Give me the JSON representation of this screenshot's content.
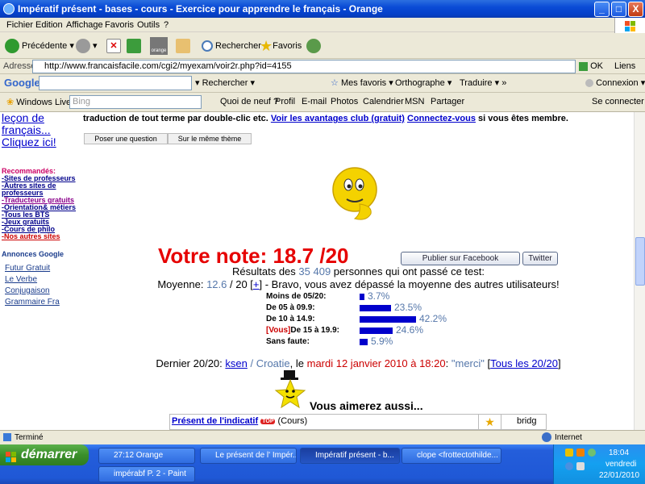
{
  "window": {
    "title": "Impératif présent - bases - cours - Exercice pour apprendre le français - Orange",
    "min": "_",
    "max": "□",
    "close": "X"
  },
  "menu": [
    "Fichier",
    "Edition",
    "Affichage",
    "Favoris",
    "Outils",
    "?"
  ],
  "toolbar": {
    "back": "Précédente",
    "search": "Rechercher",
    "favorites": "Favoris",
    "orange": "orange"
  },
  "address": {
    "label": "Adresse",
    "url": "http://www.francaisfacile.com/cgi2/myexam/voir2r.php?id=4155",
    "go": "OK",
    "links": "Liens"
  },
  "googlebar": {
    "logo": "Google",
    "search": "Rechercher",
    "favorites": "Mes favoris",
    "spell": "Orthographe",
    "translate": "Traduire",
    "connect": "Connexion"
  },
  "livebar": {
    "brand": "Windows Live",
    "placeholder": "Bing",
    "items": [
      "Quoi de neuf ?",
      "Profil",
      "E-mail",
      "Photos",
      "Calendrier",
      "MSN",
      "Partager"
    ],
    "signin": "Se connecter"
  },
  "sidebar": {
    "promo": "leçon de français... Cliquez ici!",
    "reco_title": "Recommandés:",
    "reco": [
      {
        "label": "Sites de professeurs",
        "color": "#00008b"
      },
      {
        "label": "Autres sites de professeurs",
        "color": "#00008b"
      },
      {
        "label": "Traducteurs gratuits",
        "color": "#8b008b"
      },
      {
        "label": "Orientation& métiers",
        "color": "#00008b"
      },
      {
        "label": "Tous les BTS",
        "color": "#00008b"
      },
      {
        "label": "Jeux gratuits",
        "color": "#00008b"
      },
      {
        "label": "Cours de philo",
        "color": "#00008b"
      },
      {
        "label": "Nos autres sites",
        "color": "#cc0000"
      }
    ],
    "ads_title": "Annonces Google",
    "ads": [
      "Futur Gratuit",
      "Le Verbe",
      "Conjugaison",
      "Grammaire Fra"
    ]
  },
  "main": {
    "top_text": "traduction de tout terme par double-clic etc.",
    "top_link1": "Voir les avantages club (gratuit)",
    "top_link2": "Connectez-vous",
    "top_tail": "si vous êtes membre.",
    "tab1": "Poser une question",
    "tab2": "Sur le même thème",
    "score_label": "Votre note: 18.7 /20",
    "fb_button": "Publier sur Facebook",
    "tw_button": "Twitter",
    "results_prefix": "Résultats des",
    "results_count": "35 409",
    "results_suffix": "personnes qui ont passé ce test:",
    "avg_prefix": "Moyenne:",
    "avg_value": "12.6",
    "avg_mid": "/ 20 [",
    "avg_plus": "+",
    "avg_suffix": "] - Bravo, vous avez dépassé la moyenne des autres utilisateurs!",
    "dist": [
      {
        "label": "Moins de 05/20:",
        "you": "",
        "pct": "3.7%",
        "value": 3.7
      },
      {
        "label": "De 05 à 09.9:",
        "you": "",
        "pct": "23.5%",
        "value": 23.5
      },
      {
        "label": "De 10 à 14.9:",
        "you": "",
        "pct": "42.2%",
        "value": 42.2
      },
      {
        "label": "De 15 à 19.9:",
        "you": "[Vous]",
        "pct": "24.6%",
        "value": 24.6
      },
      {
        "label": "Sans faute:",
        "you": "",
        "pct": "5.9%",
        "value": 5.9
      }
    ],
    "last_prefix": "Dernier 20/20:",
    "last_user": "ksen",
    "last_country": "/ Croatie",
    "last_le": ", le",
    "last_date": "mardi 12 janvier 2010 à 18:20",
    "last_colon": ":",
    "last_msg": "\"merci\"",
    "last_all": "Tous les 20/20",
    "like_title": "Vous aimerez aussi...",
    "like_link": "Présent de l'indicatif",
    "like_top": "TOP",
    "like_type": "(Cours)",
    "like_user": "bridg"
  },
  "status": {
    "text": "Terminé",
    "zone": "Internet"
  },
  "taskbar": {
    "start": "démarrer",
    "tasks": [
      "27:12 Orange",
      "Le présent de l' Impér...",
      "Impératif présent - b...",
      "clope <frottectothilde...",
      "impérabf P. 2 - Paint"
    ],
    "clock": "18:04",
    "day": "vendredi",
    "date": "22/01/2010"
  },
  "colors": {
    "score": "#e60000",
    "bar": "#0000cc",
    "link": "#0000cc",
    "muted": "#5577aa"
  }
}
